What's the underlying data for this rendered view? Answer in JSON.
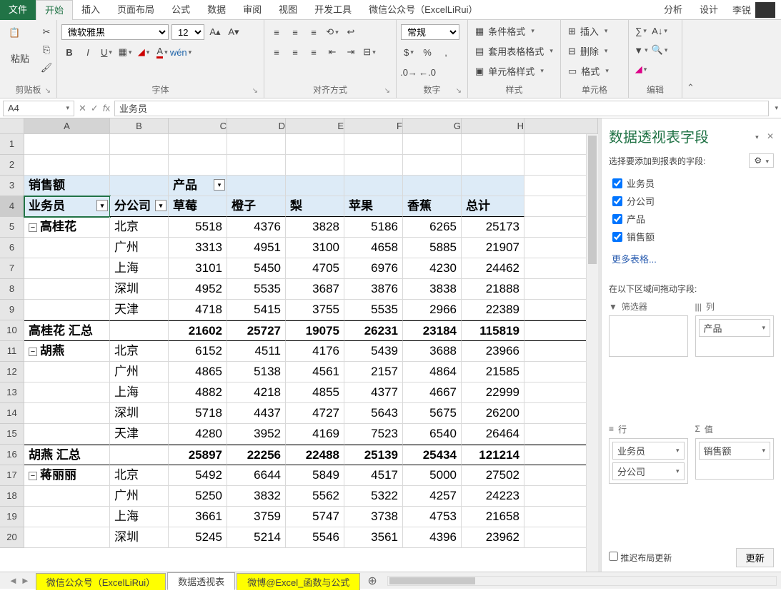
{
  "tabs": {
    "file": "文件",
    "home": "开始",
    "insert": "插入",
    "layout": "页面布局",
    "formulas": "公式",
    "data": "数据",
    "review": "审阅",
    "view": "视图",
    "dev": "开发工具",
    "wechat": "微信公众号（ExcelLiRui）",
    "analyze": "分析",
    "design": "设计"
  },
  "user": {
    "name": "李锐"
  },
  "ribbon": {
    "clipboard": {
      "paste": "粘贴",
      "label": "剪贴板"
    },
    "font": {
      "name": "微软雅黑",
      "size": "12",
      "label": "字体"
    },
    "align": {
      "label": "对齐方式"
    },
    "number": {
      "format": "常规",
      "label": "数字"
    },
    "styles": {
      "cond": "条件格式",
      "table": "套用表格格式",
      "cell": "单元格样式",
      "label": "样式"
    },
    "cells": {
      "insert": "插入",
      "delete": "删除",
      "format": "格式",
      "label": "单元格"
    },
    "editing": {
      "label": "编辑"
    }
  },
  "namebox": "A4",
  "formula": "业务员",
  "cols": [
    "A",
    "B",
    "C",
    "D",
    "E",
    "F",
    "G",
    "H"
  ],
  "pivot": {
    "r1": {
      "A": "销售额",
      "C": "产品"
    },
    "r2": {
      "A": "业务员",
      "B": "分公司",
      "C": "草莓",
      "D": "橙子",
      "E": "梨",
      "F": "苹果",
      "G": "香蕉",
      "H": "总计"
    }
  },
  "rows": [
    {
      "n": 1
    },
    {
      "n": 2
    },
    {
      "n": 3,
      "pivot_top": true
    },
    {
      "n": 4,
      "header": true
    },
    {
      "n": 5,
      "exp": true,
      "A": "高桂花",
      "B": "北京",
      "C": "5518",
      "D": "4376",
      "E": "3828",
      "F": "5186",
      "G": "6265",
      "H": "25173"
    },
    {
      "n": 6,
      "B": "广州",
      "C": "3313",
      "D": "4951",
      "E": "3100",
      "F": "4658",
      "G": "5885",
      "H": "21907"
    },
    {
      "n": 7,
      "B": "上海",
      "C": "3101",
      "D": "5450",
      "E": "4705",
      "F": "6976",
      "G": "4230",
      "H": "24462"
    },
    {
      "n": 8,
      "B": "深圳",
      "C": "4952",
      "D": "5535",
      "E": "3687",
      "F": "3876",
      "G": "3838",
      "H": "21888"
    },
    {
      "n": 9,
      "B": "天津",
      "C": "4718",
      "D": "5415",
      "E": "3755",
      "F": "5535",
      "G": "2966",
      "H": "22389"
    },
    {
      "n": 10,
      "sub": true,
      "A": "高桂花 汇总",
      "C": "21602",
      "D": "25727",
      "E": "19075",
      "F": "26231",
      "G": "23184",
      "H": "115819"
    },
    {
      "n": 11,
      "exp": true,
      "A": "胡燕",
      "B": "北京",
      "C": "6152",
      "D": "4511",
      "E": "4176",
      "F": "5439",
      "G": "3688",
      "H": "23966"
    },
    {
      "n": 12,
      "B": "广州",
      "C": "4865",
      "D": "5138",
      "E": "4561",
      "F": "2157",
      "G": "4864",
      "H": "21585"
    },
    {
      "n": 13,
      "B": "上海",
      "C": "4882",
      "D": "4218",
      "E": "4855",
      "F": "4377",
      "G": "4667",
      "H": "22999"
    },
    {
      "n": 14,
      "B": "深圳",
      "C": "5718",
      "D": "4437",
      "E": "4727",
      "F": "5643",
      "G": "5675",
      "H": "26200"
    },
    {
      "n": 15,
      "B": "天津",
      "C": "4280",
      "D": "3952",
      "E": "4169",
      "F": "7523",
      "G": "6540",
      "H": "26464"
    },
    {
      "n": 16,
      "sub": true,
      "A": "胡燕 汇总",
      "C": "25897",
      "D": "22256",
      "E": "22488",
      "F": "25139",
      "G": "25434",
      "H": "121214"
    },
    {
      "n": 17,
      "exp": true,
      "A": "蒋丽丽",
      "B": "北京",
      "C": "5492",
      "D": "6644",
      "E": "5849",
      "F": "4517",
      "G": "5000",
      "H": "27502"
    },
    {
      "n": 18,
      "B": "广州",
      "C": "5250",
      "D": "3832",
      "E": "5562",
      "F": "5322",
      "G": "4257",
      "H": "24223"
    },
    {
      "n": 19,
      "B": "上海",
      "C": "3661",
      "D": "3759",
      "E": "5747",
      "F": "3738",
      "G": "4753",
      "H": "21658"
    },
    {
      "n": 20,
      "B": "深圳",
      "C": "5245",
      "D": "5214",
      "E": "5546",
      "F": "3561",
      "G": "4396",
      "H": "23962"
    }
  ],
  "pane": {
    "title": "数据透视表字段",
    "sub": "选择要添加到报表的字段:",
    "fields": [
      "业务员",
      "分公司",
      "产品",
      "销售额"
    ],
    "more": "更多表格...",
    "dragLabel": "在以下区域间拖动字段:",
    "areas": {
      "filter": "筛选器",
      "cols": "列",
      "rows": "行",
      "values": "值"
    },
    "colItems": [
      "产品"
    ],
    "rowItems": [
      "业务员",
      "分公司"
    ],
    "valItems": [
      "销售额"
    ],
    "defer": "推迟布局更新",
    "update": "更新"
  },
  "sheets": {
    "s1": "微信公众号（ExcelLiRui）",
    "s2": "数据透视表",
    "s3": "微博@Excel_函数与公式"
  }
}
